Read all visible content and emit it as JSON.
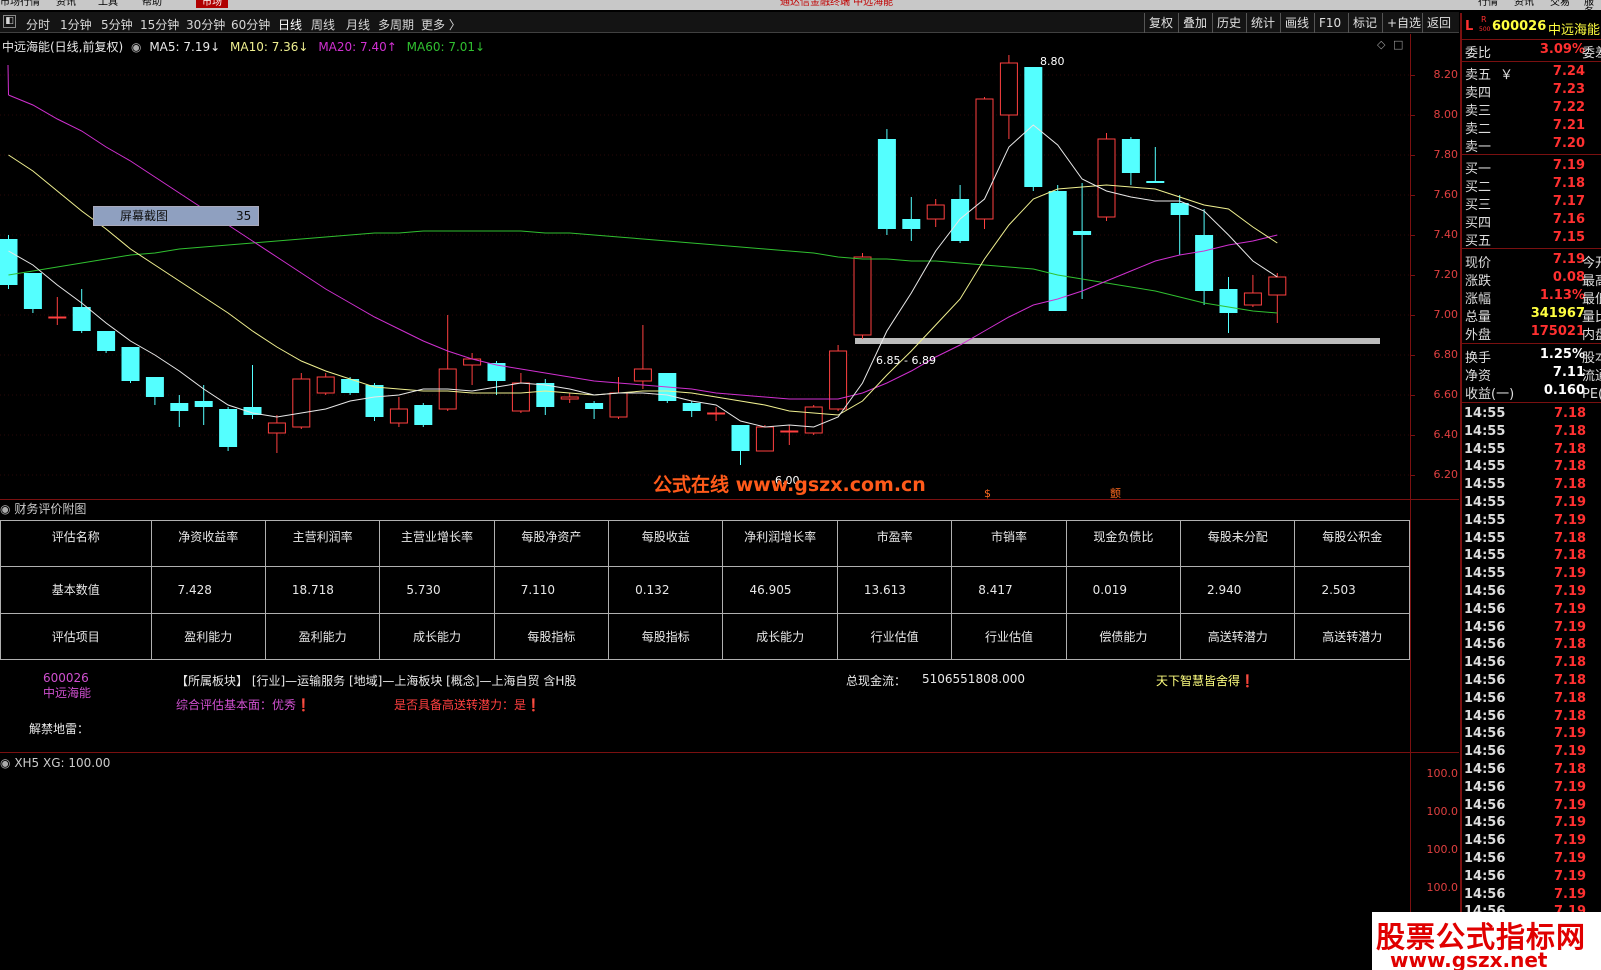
{
  "top_menu": {
    "items": [
      "市场行情",
      "资讯",
      "工具",
      "帮助"
    ],
    "active_tab": "市场",
    "center_title": "通达信金融终端  中远海能",
    "right_tabs": [
      "行情",
      "资讯",
      "交易",
      "服务"
    ]
  },
  "period_bar": {
    "items": [
      "分时",
      "1分钟",
      "5分钟",
      "15分钟",
      "30分钟",
      "60分钟",
      "日线",
      "周线",
      "月线",
      "多周期",
      "更多 〉"
    ],
    "active": "日线"
  },
  "toolbar": {
    "buttons": [
      "复权",
      "叠加",
      "历史",
      "统计",
      "画线",
      "F10",
      "标记",
      "+自选",
      "返回"
    ]
  },
  "chart_title": {
    "name": "中远海能(日线,前复权)",
    "ma5": "MA5: 7.19",
    "ma10": "MA10: 7.36",
    "ma20": "MA20: 7.40",
    "ma60": "MA60: 7.01",
    "arrow_down": "↓",
    "arrow_up": "↑"
  },
  "colors": {
    "up": "#ff4040",
    "down": "#54ffff",
    "ma5": "#e8e8e8",
    "ma10": "#f0f090",
    "ma20": "#d030d0",
    "ma60": "#30c030",
    "price_axis": "#e04040"
  },
  "screenshot_label": {
    "text": "屏幕截图",
    "count": "35"
  },
  "annotations": {
    "high": "8.80",
    "low": "6.00",
    "range": "6.85 - 6.89",
    "marker_s": "$",
    "marker_2": "颤"
  },
  "chart_data": {
    "type": "candlestick",
    "title": "中远海能(日线,前复权)",
    "y_ticks": [
      "8.20",
      "8.00",
      "7.80",
      "7.60",
      "7.40",
      "7.20",
      "7.00",
      "6.80",
      "6.60",
      "6.40",
      "6.20"
    ],
    "ylim": [
      6.12,
      8.34
    ],
    "candles": [
      {
        "o": 7.38,
        "c": 7.15,
        "h": 7.4,
        "l": 7.13
      },
      {
        "o": 7.21,
        "c": 7.03,
        "h": 7.21,
        "l": 7.01
      },
      {
        "o": 6.99,
        "c": 6.99,
        "h": 7.09,
        "l": 6.95
      },
      {
        "o": 7.04,
        "c": 6.92,
        "h": 7.13,
        "l": 6.91
      },
      {
        "o": 6.92,
        "c": 6.82,
        "h": 6.92,
        "l": 6.81
      },
      {
        "o": 6.84,
        "c": 6.67,
        "h": 6.84,
        "l": 6.66
      },
      {
        "o": 6.69,
        "c": 6.59,
        "h": 6.69,
        "l": 6.55
      },
      {
        "o": 6.56,
        "c": 6.52,
        "h": 6.6,
        "l": 6.44
      },
      {
        "o": 6.57,
        "c": 6.54,
        "h": 6.65,
        "l": 6.45
      },
      {
        "o": 6.53,
        "c": 6.34,
        "h": 6.54,
        "l": 6.32
      },
      {
        "o": 6.54,
        "c": 6.5,
        "h": 6.75,
        "l": 6.48
      },
      {
        "o": 6.41,
        "c": 6.46,
        "h": 6.5,
        "l": 6.31
      },
      {
        "o": 6.44,
        "c": 6.68,
        "h": 6.71,
        "l": 6.43
      },
      {
        "o": 6.61,
        "c": 6.69,
        "h": 6.71,
        "l": 6.6
      },
      {
        "o": 6.68,
        "c": 6.61,
        "h": 6.69,
        "l": 6.6
      },
      {
        "o": 6.65,
        "c": 6.49,
        "h": 6.66,
        "l": 6.47
      },
      {
        "o": 6.46,
        "c": 6.53,
        "h": 6.59,
        "l": 6.44
      },
      {
        "o": 6.55,
        "c": 6.45,
        "h": 6.56,
        "l": 6.44
      },
      {
        "o": 6.53,
        "c": 6.73,
        "h": 7.0,
        "l": 6.52
      },
      {
        "o": 6.75,
        "c": 6.78,
        "h": 6.81,
        "l": 6.65
      },
      {
        "o": 6.76,
        "c": 6.67,
        "h": 6.77,
        "l": 6.6
      },
      {
        "o": 6.52,
        "c": 6.66,
        "h": 6.71,
        "l": 6.51
      },
      {
        "o": 6.66,
        "c": 6.54,
        "h": 6.68,
        "l": 6.5
      },
      {
        "o": 6.58,
        "c": 6.59,
        "h": 6.61,
        "l": 6.56
      },
      {
        "o": 6.56,
        "c": 6.53,
        "h": 6.57,
        "l": 6.48
      },
      {
        "o": 6.49,
        "c": 6.61,
        "h": 6.69,
        "l": 6.48
      },
      {
        "o": 6.67,
        "c": 6.73,
        "h": 6.95,
        "l": 6.63
      },
      {
        "o": 6.71,
        "c": 6.57,
        "h": 6.71,
        "l": 6.56
      },
      {
        "o": 6.56,
        "c": 6.52,
        "h": 6.57,
        "l": 6.49
      },
      {
        "o": 6.51,
        "c": 6.51,
        "h": 6.54,
        "l": 6.47
      },
      {
        "o": 6.45,
        "c": 6.32,
        "h": 6.45,
        "l": 6.25
      },
      {
        "o": 6.32,
        "c": 6.44,
        "h": 6.45,
        "l": 6.32
      },
      {
        "o": 6.42,
        "c": 6.42,
        "h": 6.45,
        "l": 6.35
      },
      {
        "o": 6.41,
        "c": 6.54,
        "h": 6.55,
        "l": 6.4
      },
      {
        "o": 6.53,
        "c": 6.82,
        "h": 6.85,
        "l": 6.52
      },
      {
        "o": 6.9,
        "c": 7.29,
        "h": 7.31,
        "l": 6.88
      },
      {
        "o": 7.88,
        "c": 7.43,
        "h": 7.93,
        "l": 7.4
      },
      {
        "o": 7.48,
        "c": 7.43,
        "h": 7.59,
        "l": 7.37
      },
      {
        "o": 7.48,
        "c": 7.55,
        "h": 7.58,
        "l": 7.44
      },
      {
        "o": 7.58,
        "c": 7.37,
        "h": 7.65,
        "l": 7.36
      },
      {
        "o": 7.48,
        "c": 8.08,
        "h": 8.09,
        "l": 7.43
      },
      {
        "o": 8.0,
        "c": 8.26,
        "h": 8.3,
        "l": 7.88
      },
      {
        "o": 8.24,
        "c": 7.64,
        "h": 8.24,
        "l": 7.62
      },
      {
        "o": 7.62,
        "c": 7.02,
        "h": 7.65,
        "l": 7.02
      },
      {
        "o": 7.42,
        "c": 7.4,
        "h": 7.66,
        "l": 7.08
      },
      {
        "o": 7.49,
        "c": 7.88,
        "h": 7.91,
        "l": 7.47
      },
      {
        "o": 7.88,
        "c": 7.71,
        "h": 7.89,
        "l": 7.65
      },
      {
        "o": 7.67,
        "c": 7.66,
        "h": 7.84,
        "l": 7.66
      },
      {
        "o": 7.56,
        "c": 7.5,
        "h": 7.6,
        "l": 7.3
      },
      {
        "o": 7.4,
        "c": 7.12,
        "h": 7.53,
        "l": 7.05
      },
      {
        "o": 7.13,
        "c": 7.01,
        "h": 7.19,
        "l": 6.91
      },
      {
        "o": 7.05,
        "c": 7.11,
        "h": 7.2,
        "l": 7.04
      },
      {
        "o": 7.1,
        "c": 7.19,
        "h": 7.21,
        "l": 6.96
      }
    ],
    "ma5": [
      7.32,
      7.25,
      7.15,
      7.06,
      6.96,
      6.87,
      6.8,
      6.72,
      6.63,
      6.55,
      6.51,
      6.49,
      6.51,
      6.53,
      6.57,
      6.59,
      6.6,
      6.63,
      6.63,
      6.62,
      6.64,
      6.66,
      6.65,
      6.63,
      6.6,
      6.61,
      6.61,
      6.6,
      6.57,
      6.55,
      6.47,
      6.44,
      6.45,
      6.44,
      6.49,
      6.66,
      6.92,
      7.11,
      7.32,
      7.48,
      7.58,
      7.84,
      7.95,
      7.85,
      7.68,
      7.62,
      7.59,
      7.57,
      7.57,
      7.52,
      7.4,
      7.27,
      7.19
    ],
    "ma10": [
      7.8,
      7.72,
      7.62,
      7.52,
      7.43,
      7.33,
      7.25,
      7.17,
      7.09,
      7.01,
      6.92,
      6.84,
      6.77,
      6.72,
      6.68,
      6.64,
      6.63,
      6.62,
      6.62,
      6.61,
      6.61,
      6.61,
      6.62,
      6.61,
      6.6,
      6.61,
      6.62,
      6.62,
      6.61,
      6.59,
      6.57,
      6.55,
      6.52,
      6.51,
      6.5,
      6.57,
      6.7,
      6.82,
      6.95,
      7.08,
      7.28,
      7.45,
      7.58,
      7.63,
      7.64,
      7.65,
      7.64,
      7.63,
      7.59,
      7.55,
      7.53,
      7.44,
      7.36
    ],
    "ma20": [
      8.1,
      8.05,
      7.98,
      7.92,
      7.84,
      7.77,
      7.69,
      7.61,
      7.53,
      7.45,
      7.37,
      7.29,
      7.21,
      7.13,
      7.06,
      6.99,
      6.93,
      6.87,
      6.82,
      6.78,
      6.75,
      6.73,
      6.71,
      6.69,
      6.67,
      6.66,
      6.65,
      6.64,
      6.63,
      6.61,
      6.6,
      6.59,
      6.58,
      6.58,
      6.58,
      6.61,
      6.66,
      6.72,
      6.79,
      6.85,
      6.92,
      6.99,
      7.05,
      7.08,
      7.12,
      7.17,
      7.22,
      7.27,
      7.3,
      7.32,
      7.35,
      7.37,
      7.4
    ],
    "ma60": [
      7.2,
      7.22,
      7.24,
      7.26,
      7.28,
      7.3,
      7.31,
      7.33,
      7.34,
      7.35,
      7.36,
      7.37,
      7.38,
      7.39,
      7.4,
      7.41,
      7.41,
      7.42,
      7.42,
      7.42,
      7.42,
      7.42,
      7.41,
      7.41,
      7.4,
      7.39,
      7.38,
      7.37,
      7.36,
      7.35,
      7.34,
      7.33,
      7.32,
      7.31,
      7.29,
      7.28,
      7.28,
      7.27,
      7.27,
      7.26,
      7.25,
      7.24,
      7.23,
      7.2,
      7.18,
      7.16,
      7.14,
      7.12,
      7.09,
      7.06,
      7.04,
      7.02,
      7.01
    ],
    "support_line": 6.87
  },
  "finance_panel": {
    "title": "财务评价附图",
    "headers": [
      "评估名称",
      "净资收益率",
      "主营利润率",
      "主营业增长率",
      "每股净资产",
      "每股收益",
      "净利润增长率",
      "市盈率",
      "市销率",
      "现金负债比",
      "每股未分配",
      "每股公积金"
    ],
    "values": [
      "基本数值",
      "7.428",
      "18.718",
      "5.730",
      "7.110",
      "0.132",
      "46.905",
      "13.613",
      "8.417",
      "0.019",
      "2.940",
      "2.503"
    ],
    "items": [
      "评估项目",
      "盈利能力",
      "盈利能力",
      "成长能力",
      "每股指标",
      "每股指标",
      "成长能力",
      "行业估值",
      "行业估值",
      "偿债能力",
      "高送转潜力",
      "高送转潜力"
    ],
    "stock_code": "600026",
    "stock_name": "中远海能",
    "sector": "【所属板块】 [行业]—运输服务 [地域]—上海板块 [概念]—上海自贸 含H股",
    "cash_flow_label": "总现金流：",
    "cash_flow_value": "5106551808.000",
    "motto": "天下智慧皆舍得❗",
    "overall_eval": "综合评估基本面：优秀❗",
    "high_transfer": "是否具备高送转潜力：是❗",
    "unlock_label": "解禁地雷："
  },
  "xh5_panel": {
    "title": "XH5  XG: 100.00",
    "y_ticks": [
      "100.0",
      "100.0",
      "100.0",
      "100.0"
    ]
  },
  "side_panel": {
    "l_mark": "L",
    "r_mark": "R",
    "r_sub": "500",
    "code": "600026",
    "name": "中远海能",
    "wb_label": "委比",
    "wb_value": "3.09%",
    "wb_extra": "委差",
    "sells": [
      {
        "label": "卖五",
        "price": "7.24"
      },
      {
        "label": "卖四",
        "price": "7.23"
      },
      {
        "label": "卖三",
        "price": "7.22"
      },
      {
        "label": "卖二",
        "price": "7.21"
      },
      {
        "label": "卖一",
        "price": "7.20"
      }
    ],
    "yen": "￥",
    "buys": [
      {
        "label": "买一",
        "price": "7.19"
      },
      {
        "label": "买二",
        "price": "7.18"
      },
      {
        "label": "买三",
        "price": "7.17"
      },
      {
        "label": "买四",
        "price": "7.16"
      },
      {
        "label": "买五",
        "price": "7.15"
      }
    ],
    "quotes": [
      {
        "label": "现价",
        "value": "7.19",
        "extra": "今开",
        "color": "#ff3030"
      },
      {
        "label": "涨跌",
        "value": "0.08",
        "extra": "最高",
        "color": "#ff3030"
      },
      {
        "label": "涨幅",
        "value": "1.13%",
        "extra": "最低",
        "color": "#ff3030"
      },
      {
        "label": "总量",
        "value": "341967",
        "extra": "量比",
        "color": "#ffff40"
      },
      {
        "label": "外盘",
        "value": "175021",
        "extra": "内盘",
        "color": "#ff3030"
      }
    ],
    "quotes2": [
      {
        "label": "换手",
        "value": "1.25%",
        "extra": "股本",
        "color": "#ffffff"
      },
      {
        "label": "净资",
        "value": "7.11",
        "extra": "流通",
        "color": "#ffffff"
      },
      {
        "label": "收益(一)",
        "value": "0.160",
        "extra": "PE(动)",
        "color": "#ffffff"
      }
    ],
    "ticks": [
      {
        "t": "14:55",
        "p": "7.18"
      },
      {
        "t": "14:55",
        "p": "7.18"
      },
      {
        "t": "14:55",
        "p": "7.18"
      },
      {
        "t": "14:55",
        "p": "7.18"
      },
      {
        "t": "14:55",
        "p": "7.18"
      },
      {
        "t": "14:55",
        "p": "7.19"
      },
      {
        "t": "14:55",
        "p": "7.19"
      },
      {
        "t": "14:55",
        "p": "7.18"
      },
      {
        "t": "14:55",
        "p": "7.18"
      },
      {
        "t": "14:55",
        "p": "7.19"
      },
      {
        "t": "14:56",
        "p": "7.19"
      },
      {
        "t": "14:56",
        "p": "7.19"
      },
      {
        "t": "14:56",
        "p": "7.19"
      },
      {
        "t": "14:56",
        "p": "7.18"
      },
      {
        "t": "14:56",
        "p": "7.18"
      },
      {
        "t": "14:56",
        "p": "7.18"
      },
      {
        "t": "14:56",
        "p": "7.18"
      },
      {
        "t": "14:56",
        "p": "7.18"
      },
      {
        "t": "14:56",
        "p": "7.19"
      },
      {
        "t": "14:56",
        "p": "7.19"
      },
      {
        "t": "14:56",
        "p": "7.18"
      },
      {
        "t": "14:56",
        "p": "7.19"
      },
      {
        "t": "14:56",
        "p": "7.19"
      },
      {
        "t": "14:56",
        "p": "7.19"
      },
      {
        "t": "14:56",
        "p": "7.19"
      },
      {
        "t": "14:56",
        "p": "7.19"
      },
      {
        "t": "14:56",
        "p": "7.19"
      },
      {
        "t": "14:56",
        "p": "7.19"
      },
      {
        "t": "14:56",
        "p": "7.19"
      },
      {
        "t": "14:56",
        "p": "7.19"
      },
      {
        "t": "14:56",
        "p": "7.19"
      }
    ]
  },
  "watermarks": {
    "gszx": "公式在线  www.gszx.com.cn",
    "corner1": "股票公式指标网",
    "corner2": "www.gszx.net"
  }
}
